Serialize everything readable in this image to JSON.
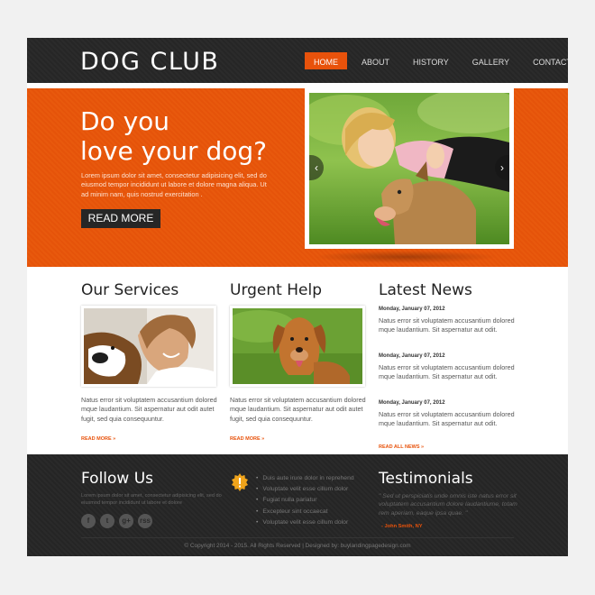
{
  "header": {
    "logo": "DOG CLUB",
    "nav": [
      "HOME",
      "ABOUT",
      "HISTORY",
      "GALLERY",
      "CONTACTS"
    ]
  },
  "hero": {
    "title_line1": "Do you",
    "title_line2": "love your dog?",
    "text": "Lorem ipsum dolor sit amet, consectetur adipisicing elit, sed do eiusmod tempor incididunt ut labore et dolore magna aliqua. Ut ad minim nam, quis nostrud exercitation .",
    "button": "READ MORE",
    "arrow_left": "‹",
    "arrow_right": "›"
  },
  "services": {
    "title": "Our Services",
    "text": "Natus error sit voluptatem accusantium dolored mque laudantium. Sit aspernatur aut odit autet fugit, sed quia consequuntur.",
    "more": "READ MORE »"
  },
  "urgent": {
    "title": "Urgent Help",
    "text": "Natus error sit voluptatem accusantium dolored mque laudantium. Sit aspernatur aut odit autet fugit, sed quia consequuntur.",
    "more": "READ MORE »"
  },
  "news": {
    "title": "Latest News",
    "items": [
      {
        "date": "Monday, January 07, 2012",
        "text": "Natus error sit voluptatem accusantium dolored mque laudantium. Sit aspernatur aut odit."
      },
      {
        "date": "Monday, January 07, 2012",
        "text": "Natus error sit voluptatem accusantium dolored mque laudantium. Sit aspernatur aut odit."
      },
      {
        "date": "Monday, January 07, 2012",
        "text": "Natus error sit voluptatem accusantium dolored mque laudantium. Sit aspernatur aut odit."
      }
    ],
    "more": "READ ALL NEWS »"
  },
  "footer": {
    "follow_title": "Follow Us",
    "follow_text": "Lorem ipsum dolor sit amet, consectetur adipisicing elit, sed do eiusmod tempor incididunt ut labore et dolore",
    "social": [
      "f",
      "t",
      "g+",
      "rss"
    ],
    "list": [
      "Duis aute irure dolor in reprehend",
      "Voluptate velit esse cillum dolor",
      "Fugiat nulla pariatur",
      "Excepteur sint occaecat",
      "Voluptate velit esse cillum dolor"
    ],
    "testimonials_title": "Testimonials",
    "quote": "\" Sed ut perspiciatis unde omnis iste natus error sit voluptatem accusantium dolore laudantiume, totam rem aperiam, eaque ipsa quae. \"",
    "author": "- John Smith, NY",
    "copyright": "© Copyright 2014 - 2015. All Rights Reserved | Designed by: buylandingpagedesign.com"
  },
  "colors": {
    "accent": "#e8520b",
    "dark": "#2a2a2a"
  }
}
